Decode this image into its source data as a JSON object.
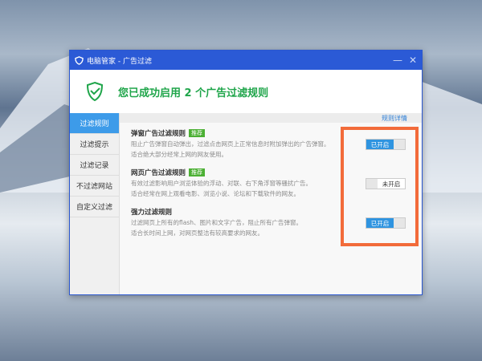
{
  "window": {
    "title": "电脑管家 - 广告过滤",
    "minimize": "—",
    "close": "✕"
  },
  "header": {
    "message": "您已成功启用 2 个广告过滤规则"
  },
  "rule_details_link": "规则详情",
  "sidebar": {
    "items": [
      {
        "label": "过滤规则",
        "active": true
      },
      {
        "label": "过滤提示"
      },
      {
        "label": "过滤记录"
      },
      {
        "label": "不过滤网站"
      },
      {
        "label": "自定义过滤"
      }
    ]
  },
  "rules": [
    {
      "name": "弹窗广告过滤规则",
      "badge": "推荐",
      "desc1": "阻止广告弹窗自动弹出，过滤点击网页上正常信息时附加弹出的广告弹窗。",
      "desc2": "适合绝大部分经常上网的网友使用。",
      "toggle": "已开启",
      "enabled": true
    },
    {
      "name": "网页广告过滤规则",
      "badge": "推荐",
      "desc1": "有效过滤影响用户浏览体验的浮动、对联、右下角浮窗等骚扰广告。",
      "desc2": "适合经常在网上观看电影、浏览小说、论坛和下载软件的网友。",
      "toggle": "未开启",
      "enabled": false
    },
    {
      "name": "强力过滤规则",
      "desc1": "过滤网页上所有的flash、图片和文字广告，阻止所有广告弹窗。",
      "desc2": "适合长时间上网，对网页整洁有较高要求的网友。",
      "toggle": "已开启",
      "enabled": true
    }
  ],
  "colors": {
    "titlebar": "#2b5ad6",
    "accent": "#1fa54a",
    "highlight": "#f26b3a"
  }
}
